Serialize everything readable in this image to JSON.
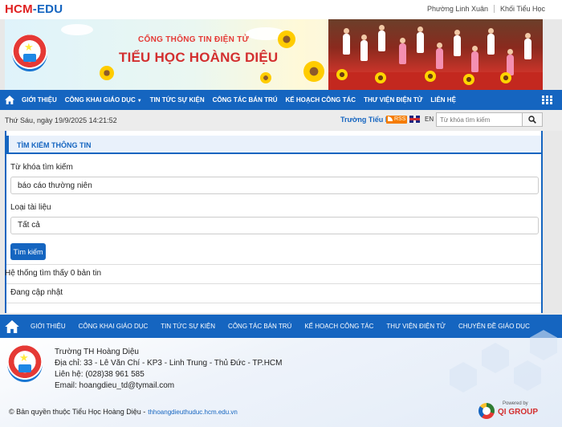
{
  "header": {
    "brand_primary": "HCM",
    "brand_secondary": "-EDU",
    "top_links": [
      "Phường Linh Xuân",
      "Khối Tiểu Học"
    ]
  },
  "banner": {
    "subtitle": "CỔNG THÔNG TIN ĐIỆN TỬ",
    "school_name": "TIỂU HỌC HOÀNG DIỆU"
  },
  "nav": {
    "items": [
      "GIỚI THIỆU",
      "CÔNG KHAI GIÁO DỤC",
      "TIN TỨC SỰ KIỆN",
      "CÔNG TÁC BÁN TRÚ",
      "KẾ HOẠCH CÔNG TÁC",
      "THƯ VIỆN ĐIỆN TỬ",
      "LIÊN HỆ"
    ]
  },
  "infobar": {
    "date": "Thứ Sáu, ngày 19/9/2025 14:21:52",
    "ticker": "Trường Tiểu h",
    "rss_label": "RSS",
    "lang": "EN",
    "search_placeholder": "Từ khóa tìm kiếm"
  },
  "search_panel": {
    "title": "TÌM KIẾM THÔNG TIN",
    "keyword_label": "Từ khóa tìm kiếm",
    "keyword_value": "báo cáo thường niên",
    "doc_type_label": "Loại tài liệu",
    "doc_type_value": "Tất cả",
    "submit_label": "Tìm kiếm",
    "result_text": "Hệ thống tìm thấy 0 bản tin",
    "status_text": "Đang cập nhật"
  },
  "footer_nav": {
    "items": [
      "GIỚI THIỆU",
      "CÔNG KHAI GIÁO DỤC",
      "TIN TỨC SỰ KIỆN",
      "CÔNG TÁC BÁN TRÚ",
      "KẾ HOẠCH CÔNG TÁC",
      "THƯ VIỆN ĐIỆN TỬ",
      "CHUYÊN ĐỀ GIÁO DỤC"
    ]
  },
  "footer": {
    "school": "Trường TH Hoàng Diệu",
    "address": "Địa chỉ: 33 - Lê Văn Chí - KP3 - Linh Trung - Thủ Đức - TP.HCM",
    "phone": "Liên hệ: (028)38 961 585",
    "email": "Email: hoangdieu_td@tymail.com",
    "copyright": "© Bản quyền thuộc Tiểu Học Hoàng Diệu -",
    "url": "thhoangdieuthuduc.hcm.edu.vn",
    "powered_by": "Powered by",
    "vendor": "QI GROUP"
  },
  "icons": {
    "home": "home-icon",
    "apps": "apps-grid-icon",
    "search": "search-icon",
    "rss": "rss-icon",
    "flag": "uk-flag-icon"
  },
  "colors": {
    "brand_blue": "#1565c0",
    "brand_red": "#e02020"
  }
}
